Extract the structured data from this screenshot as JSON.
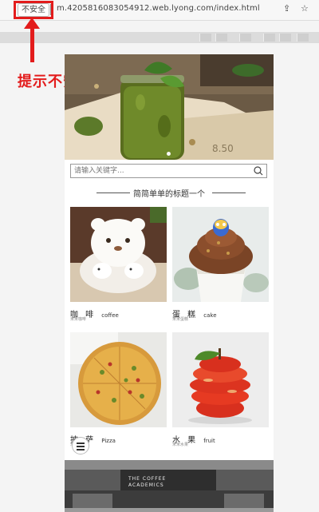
{
  "browser": {
    "security_label": "不安全",
    "url": "m.4205816083054912.web.lyong.com/index.html"
  },
  "annotation": {
    "hint": "提示不安全"
  },
  "search": {
    "placeholder": "请输入关键字..."
  },
  "section": {
    "title": "简简单单的标题一个"
  },
  "products": [
    {
      "cn": "咖 啡",
      "en": "coffee",
      "sub": "米米咖啡"
    },
    {
      "cn": "蛋 糕",
      "en": "cake",
      "sub": "米米蛋糕"
    },
    {
      "cn": "披 萨",
      "en": "Pizza",
      "sub": "米米披萨"
    },
    {
      "cn": "水 果",
      "en": "fruit",
      "sub": "米米水果"
    }
  ],
  "footer": {
    "sign_line1": "THE COFFEE",
    "sign_line2": "ACADEMICS"
  },
  "colors": {
    "annotation_red": "#e31c1c"
  }
}
